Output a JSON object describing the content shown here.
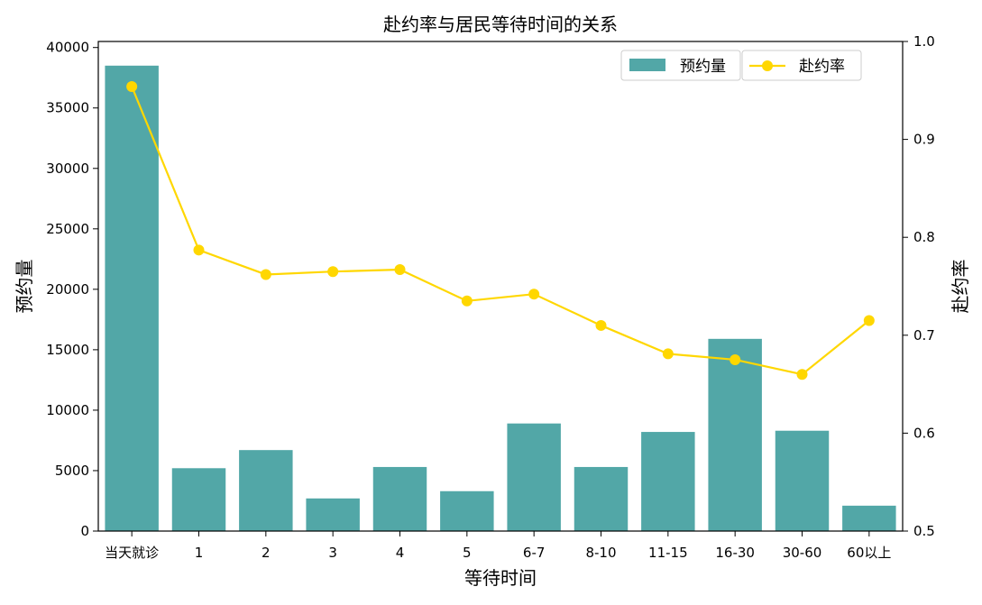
{
  "chart_data": {
    "type": "bar+line",
    "title": "赴约率与居民等待时间的关系",
    "xlabel": "等待时间",
    "ylabel_left": "预约量",
    "ylabel_right": "赴约率",
    "categories": [
      "当天就诊",
      "1",
      "2",
      "3",
      "4",
      "5",
      "6-7",
      "8-10",
      "11-15",
      "16-30",
      "30-60",
      "60以上"
    ],
    "series": [
      {
        "name": "预约量",
        "type": "bar",
        "axis": "left",
        "color": "#52a7a7",
        "values": [
          38500,
          5200,
          6700,
          2700,
          5300,
          3300,
          8900,
          5300,
          8200,
          15900,
          8300,
          2100
        ]
      },
      {
        "name": "赴约率",
        "type": "line",
        "axis": "right",
        "color": "#ffd700",
        "values": [
          0.954,
          0.787,
          0.762,
          0.765,
          0.767,
          0.735,
          0.742,
          0.71,
          0.681,
          0.675,
          0.66,
          0.715
        ]
      }
    ],
    "ylim_left": [
      0,
      40500
    ],
    "ylim_right": [
      0.5,
      1.0
    ],
    "yticks_left": [
      "0",
      "5000",
      "10000",
      "15000",
      "20000",
      "25000",
      "30000",
      "35000",
      "40000"
    ],
    "yticks_right": [
      "0.5",
      "0.6",
      "0.7",
      "0.8",
      "0.9",
      "1.0"
    ],
    "legend_placement": "top-right",
    "grid": false
  }
}
